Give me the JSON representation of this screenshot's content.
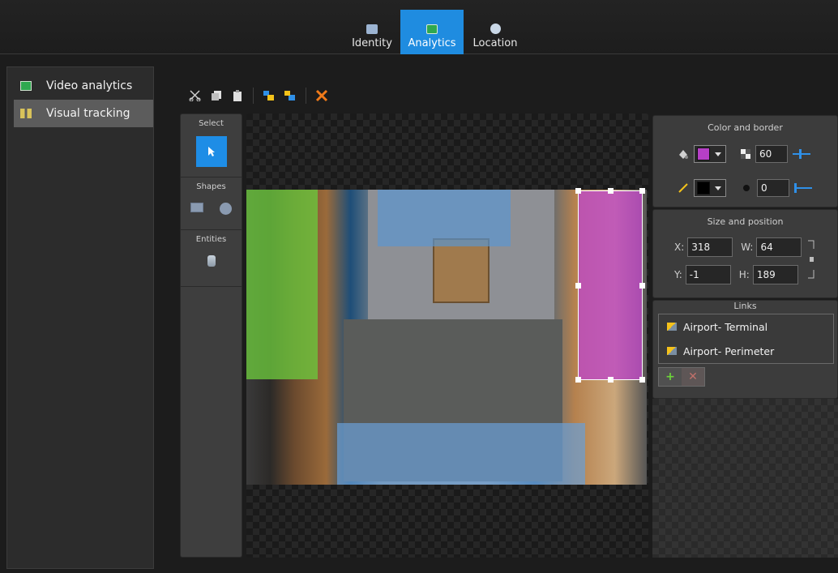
{
  "tabs": [
    {
      "label": "Identity",
      "icon": "identity-icon",
      "active": false
    },
    {
      "label": "Analytics",
      "icon": "analytics-icon",
      "active": true
    },
    {
      "label": "Location",
      "icon": "location-icon",
      "active": false
    }
  ],
  "sidebar": {
    "items": [
      {
        "label": "Video analytics",
        "icon": "video-analytics-icon",
        "selected": false
      },
      {
        "label": "Visual tracking",
        "icon": "visual-tracking-icon",
        "selected": true
      }
    ]
  },
  "toolbar": {
    "icons": [
      "cut-icon",
      "copy-icon",
      "paste-icon",
      "bring-forward-icon",
      "send-backward-icon",
      "delete-icon"
    ]
  },
  "tools": {
    "select_label": "Select",
    "shapes_label": "Shapes",
    "entities_label": "Entities"
  },
  "color_border": {
    "title": "Color and border",
    "fill_color": "#b63fc6",
    "opacity": "60",
    "border_color": "#000000",
    "border_width": "0"
  },
  "size_position": {
    "title": "Size and position",
    "x_label": "X:",
    "x": "318",
    "w_label": "W:",
    "w": "64",
    "y_label": "Y:",
    "y": "-1",
    "h_label": "H:",
    "h": "189"
  },
  "links": {
    "title": "Links",
    "items": [
      "Airport- Terminal",
      "Airport- Perimeter"
    ],
    "add_button": "+",
    "remove_button": "✕"
  },
  "colors": {
    "accent": "#1f8ce0",
    "zone_green": "#6cc83c",
    "zone_blue": "#5a96d2",
    "zone_purple": "#be46c8"
  }
}
